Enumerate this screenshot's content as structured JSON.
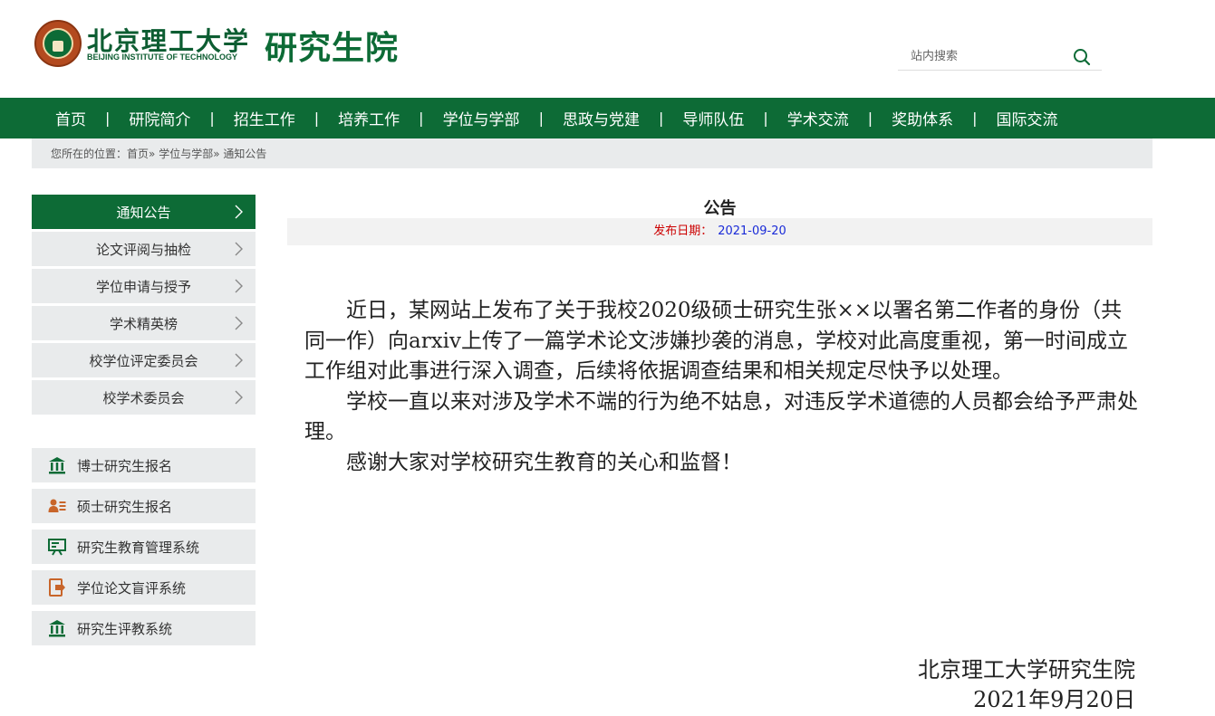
{
  "header": {
    "university_name": "北京理工大学",
    "university_en": "BEIJING INSTITUTE OF TECHNOLOGY",
    "department": "研究生院",
    "search_placeholder": "站内搜索"
  },
  "nav": {
    "items": [
      "首页",
      "研院简介",
      "招生工作",
      "培养工作",
      "学位与学部",
      "思政与党建",
      "导师队伍",
      "学术交流",
      "奖助体系",
      "国际交流"
    ],
    "separator": "|"
  },
  "breadcrumb": {
    "prefix": "您所在的位置：",
    "home": "首页",
    "sep1": "»",
    "section": "学位与学部",
    "sep2": "»",
    "current": "通知公告"
  },
  "sidebar": {
    "items": [
      {
        "label": "通知公告",
        "active": true
      },
      {
        "label": "论文评阅与抽检",
        "active": false
      },
      {
        "label": "学位申请与授予",
        "active": false
      },
      {
        "label": "学术精英榜",
        "active": false
      },
      {
        "label": "校学位评定委员会",
        "active": false
      },
      {
        "label": "校学术委员会",
        "active": false
      }
    ]
  },
  "quicklinks": {
    "items": [
      {
        "label": "博士研究生报名",
        "icon": "building-icon"
      },
      {
        "label": "硕士研究生报名",
        "icon": "student-icon"
      },
      {
        "label": "研究生教育管理系统",
        "icon": "presentation-icon"
      },
      {
        "label": "学位论文盲评系统",
        "icon": "export-doc-icon"
      },
      {
        "label": "研究生评教系统",
        "icon": "building-icon"
      }
    ]
  },
  "article": {
    "title": "公告",
    "date_label": "发布日期：",
    "date_value": "2021-09-20",
    "paragraphs": [
      "近日，某网站上发布了关于我校2020级硕士研究生张××以署名第二作者的身份（共同一作）向arxiv上传了一篇学术论文涉嫌抄袭的消息，学校对此高度重视，第一时间成立工作组对此事进行深入调查，后续将依据调查结果和相关规定尽快予以处理。",
      "学校一直以来对涉及学术不端的行为绝不姑息，对违反学术道德的人员都会给予严肃处理。",
      "感谢大家对学校研究生教育的关心和监督！"
    ],
    "signature": "北京理工大学研究生院",
    "sign_date": "2021年9月20日"
  },
  "colors": {
    "brand_green": "#0d6b36",
    "gray_bg": "#e9ebec",
    "date_label": "#cc0000",
    "date_value": "#1a2bd8",
    "icon_orange": "#c8652a"
  }
}
